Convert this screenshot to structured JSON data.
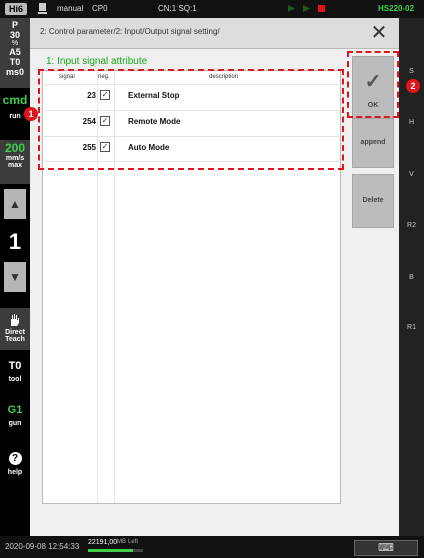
{
  "topbar": {
    "brand": "Hi6",
    "mode": "manual",
    "program": "CP0",
    "step": "CN:1 SQ:1",
    "robot_model": "HS220-02"
  },
  "leftpanel": {
    "status_p": "P",
    "status_30": "30",
    "status_pct": "%",
    "status_a5": "A5",
    "status_t0": "T0",
    "status_ms0": "ms0",
    "cmd_label": "cmd",
    "run_label": "run",
    "speed_value": "200",
    "speed_unit": "mm/s",
    "speed_max": "max",
    "up_arrow": "▲",
    "counter": "1",
    "down_arrow": "▼",
    "direct_teach_line1": "Direct",
    "direct_teach_line2": "Teach",
    "tool_value": "T0",
    "tool_label": "tool",
    "gun_value": "G1",
    "gun_label": "gun",
    "help_icon": "?",
    "help_label": "help"
  },
  "dialog": {
    "title": "2: Control parameter/2: Input/Output signal setting/",
    "close_glyph": "✕",
    "section_title": "1: Input signal attribute",
    "columns": {
      "signal": "signal",
      "neg": "neg.",
      "description": "description"
    },
    "rows": [
      {
        "signal": "23",
        "neg_checked": true,
        "description": "External Stop"
      },
      {
        "signal": "254",
        "neg_checked": true,
        "description": "Remote Mode"
      },
      {
        "signal": "255",
        "neg_checked": true,
        "description": "Auto Mode"
      }
    ],
    "buttons": {
      "ok_glyph": "✓",
      "ok": "OK",
      "append": "append",
      "delete": "Delete"
    }
  },
  "rightstrip": {
    "labels": [
      "S",
      "H",
      "V",
      "R2",
      "B",
      "R1"
    ]
  },
  "annotations": {
    "marker1": "1",
    "marker2": "2"
  },
  "bottombar": {
    "datetime": "2020-09-08 12:54:33",
    "memory_value": "22191,00",
    "memory_unit": "MB",
    "memory_suffix": "Left",
    "keyboard_icon": "⌨"
  },
  "colors": {
    "accent_green": "#3fd04a",
    "section_green": "#19a319",
    "annotation_red": "#e0141c"
  }
}
